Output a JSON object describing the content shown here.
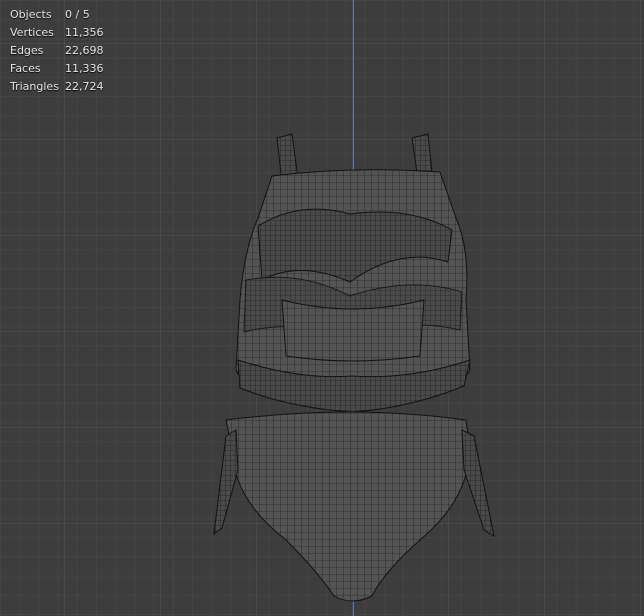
{
  "viewport": {
    "stats": [
      {
        "label": "Objects",
        "value": "0 / 5"
      },
      {
        "label": "Vertices",
        "value": "11,356"
      },
      {
        "label": "Edges",
        "value": "22,698"
      },
      {
        "label": "Faces",
        "value": "11,336"
      },
      {
        "label": "Triangles",
        "value": "22,724"
      }
    ],
    "colors": {
      "background": "#3d3d3d",
      "axis": "#4f7fbd",
      "wire": "#0a0a0a",
      "surface": "#545454"
    }
  }
}
